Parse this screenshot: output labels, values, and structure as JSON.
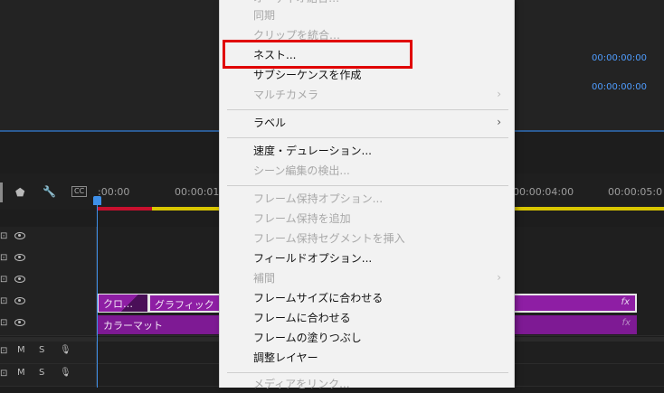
{
  "program_monitor": {
    "timecode_1": "00:00:00:00",
    "timecode_2": "00:00:00:00"
  },
  "timeline": {
    "ruler_labels": [
      ":00:00",
      "00:00:01",
      "00:00:04:00",
      "00:00:05:0"
    ],
    "clips": {
      "v2_clip_1": "クロ…",
      "v2_clip_2": "グラフィック",
      "v1_clip": "カラーマット",
      "fx_label": "fx"
    },
    "track_labels": {
      "mute": "M",
      "solo": "S"
    }
  },
  "context_menu": {
    "items": {
      "partial_top": "オーディオ結合…",
      "sync": "同期",
      "merge_clips": "クリップを統合…",
      "nest": "ネスト...",
      "make_subsequence": "サブシーケンスを作成",
      "multicamera": "マルチカメラ",
      "label": "ラベル",
      "speed_duration": "速度・デュレーション...",
      "scene_detect": "シーン編集の検出...",
      "frame_hold_options": "フレーム保持オプション...",
      "add_frame_hold": "フレーム保持を追加",
      "insert_frame_hold_segment": "フレーム保持セグメントを挿入",
      "field_options": "フィールドオプション...",
      "interpolation": "補間",
      "scale_to_frame_size": "フレームサイズに合わせる",
      "set_to_frame_size": "フレームに合わせる",
      "frame_fill": "フレームの塗りつぶし",
      "adjustment_layer": "調整レイヤー",
      "link_media": "メディアをリンク..."
    },
    "submenu_arrow": "›"
  },
  "colors": {
    "menu_bg": "#f2f2f2",
    "highlight": "#e00000",
    "clip": "#8e1ea4",
    "timecode": "#4f9dff"
  }
}
